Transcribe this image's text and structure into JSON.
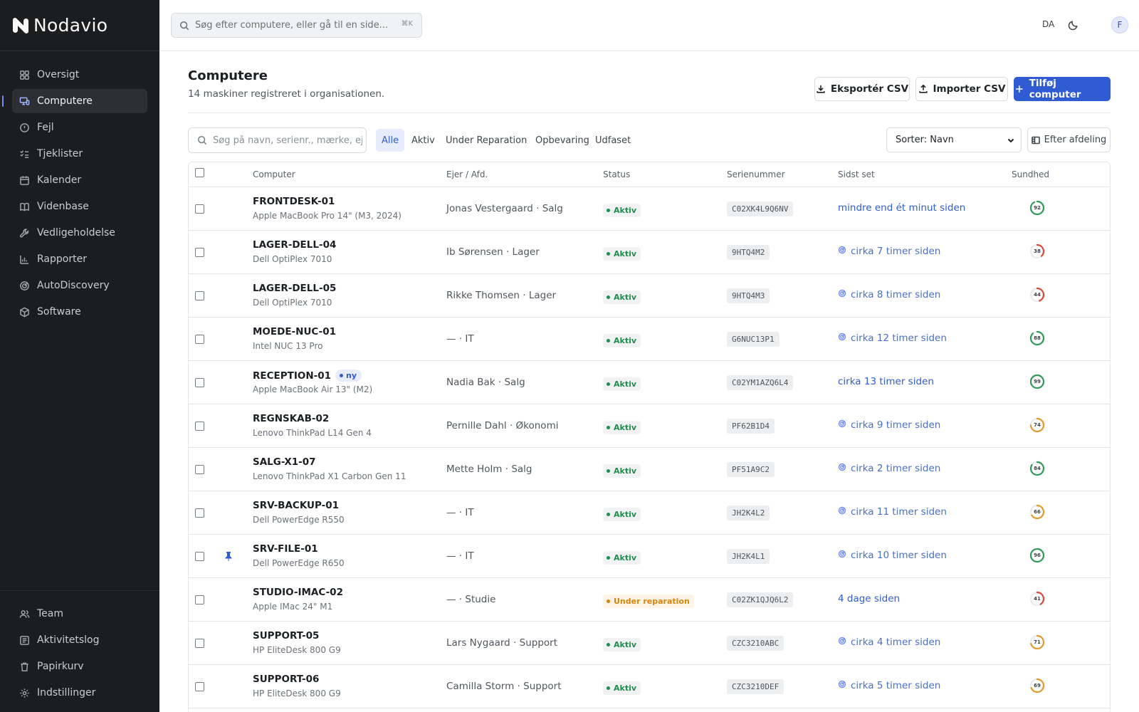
{
  "app": {
    "name": "Nodavio"
  },
  "sidebar": {
    "items": [
      {
        "label": "Oversigt",
        "icon": "grid-icon"
      },
      {
        "label": "Computere",
        "icon": "monitor-icon",
        "active": true
      },
      {
        "label": "Fejl",
        "icon": "alert-circle-icon"
      },
      {
        "label": "Tjeklister",
        "icon": "checklist-icon"
      },
      {
        "label": "Kalender",
        "icon": "calendar-icon"
      },
      {
        "label": "Videnbase",
        "icon": "book-icon"
      },
      {
        "label": "Vedligeholdelse",
        "icon": "wrench-icon"
      },
      {
        "label": "Rapporter",
        "icon": "bar-chart-icon"
      },
      {
        "label": "AutoDiscovery",
        "icon": "radar-icon"
      },
      {
        "label": "Software",
        "icon": "package-icon"
      }
    ],
    "bottom_items": [
      {
        "label": "Team",
        "icon": "users-icon"
      },
      {
        "label": "Aktivitetslog",
        "icon": "list-icon"
      },
      {
        "label": "Papirkurv",
        "icon": "trash-icon"
      },
      {
        "label": "Indstillinger",
        "icon": "gear-icon"
      }
    ]
  },
  "topbar": {
    "search_placeholder": "Søg efter computere, eller gå til en side...",
    "shortcut": "⌘K",
    "language": "DA",
    "avatar_initial": "F"
  },
  "header": {
    "title": "Computere",
    "subtitle": "14 maskiner registreret i organisationen.",
    "export_label": "Eksportér CSV",
    "import_label": "Importer CSV",
    "add_label": "Tilføj computer"
  },
  "filters": {
    "search_placeholder": "Søg på navn, serienr., mærke, ejer...",
    "tabs": [
      "Alle",
      "Aktiv",
      "Under Reparation",
      "Opbevaring",
      "Udfaset"
    ],
    "active_tab": "Alle",
    "sort_value": "Sorter: Navn",
    "group_label": "Efter afdeling"
  },
  "table": {
    "columns": [
      "Computer",
      "Ejer / Afd.",
      "Status",
      "Serienummer",
      "Sidst set",
      "Sundhed"
    ],
    "rows": [
      {
        "name": "FRONTDESK-01",
        "model": "Apple MacBook Pro 14\" (M3, 2024)",
        "owner": "Jonas Vestergaard · Salg",
        "status": "Aktiv",
        "serial": "C02XK4L9Q6NV",
        "last_seen": "mindre end ét minut siden",
        "discovered": false,
        "health": 92,
        "pinned": false,
        "new": false
      },
      {
        "name": "LAGER-DELL-04",
        "model": "Dell OptiPlex 7010",
        "owner": "Ib Sørensen · Lager",
        "status": "Aktiv",
        "serial": "9HTQ4M2",
        "last_seen": "cirka 7 timer siden",
        "discovered": true,
        "health": 38,
        "pinned": false,
        "new": false
      },
      {
        "name": "LAGER-DELL-05",
        "model": "Dell OptiPlex 7010",
        "owner": "Rikke Thomsen · Lager",
        "status": "Aktiv",
        "serial": "9HTQ4M3",
        "last_seen": "cirka 8 timer siden",
        "discovered": true,
        "health": 44,
        "pinned": false,
        "new": false
      },
      {
        "name": "MOEDE-NUC-01",
        "model": "Intel NUC 13 Pro",
        "owner": "— · IT",
        "status": "Aktiv",
        "serial": "G6NUC13P1",
        "last_seen": "cirka 12 timer siden",
        "discovered": true,
        "health": 88,
        "pinned": false,
        "new": false
      },
      {
        "name": "RECEPTION-01",
        "model": "Apple MacBook Air 13\" (M2)",
        "owner": "Nadia Bak · Salg",
        "status": "Aktiv",
        "serial": "C02YM1AZQ6L4",
        "last_seen": "cirka 13 timer siden",
        "discovered": false,
        "health": 99,
        "pinned": false,
        "new": true,
        "new_label": "ny"
      },
      {
        "name": "REGNSKAB-02",
        "model": "Lenovo ThinkPad L14 Gen 4",
        "owner": "Pernille Dahl · Økonomi",
        "status": "Aktiv",
        "serial": "PF62B1D4",
        "last_seen": "cirka 9 timer siden",
        "discovered": true,
        "health": 74,
        "pinned": false,
        "new": false
      },
      {
        "name": "SALG-X1-07",
        "model": "Lenovo ThinkPad X1 Carbon Gen 11",
        "owner": "Mette Holm · Salg",
        "status": "Aktiv",
        "serial": "PF51A9C2",
        "last_seen": "cirka 2 timer siden",
        "discovered": true,
        "health": 84,
        "pinned": false,
        "new": false
      },
      {
        "name": "SRV-BACKUP-01",
        "model": "Dell PowerEdge R550",
        "owner": "— · IT",
        "status": "Aktiv",
        "serial": "JH2K4L2",
        "last_seen": "cirka 11 timer siden",
        "discovered": true,
        "health": 66,
        "pinned": false,
        "new": false
      },
      {
        "name": "SRV-FILE-01",
        "model": "Dell PowerEdge R650",
        "owner": "— · IT",
        "status": "Aktiv",
        "serial": "JH2K4L1",
        "last_seen": "cirka 10 timer siden",
        "discovered": true,
        "health": 96,
        "pinned": true,
        "new": false
      },
      {
        "name": "STUDIO-IMAC-02",
        "model": "Apple IMac 24\" M1",
        "owner": "— · Studie",
        "status": "Under reparation",
        "serial": "C02ZK1QJQ6L2",
        "last_seen": "4 dage siden",
        "discovered": false,
        "health": 41,
        "pinned": false,
        "new": false
      },
      {
        "name": "SUPPORT-05",
        "model": "HP EliteDesk 800 G9",
        "owner": "Lars Nygaard · Support",
        "status": "Aktiv",
        "serial": "CZC3210ABC",
        "last_seen": "cirka 4 timer siden",
        "discovered": true,
        "health": 71,
        "pinned": false,
        "new": false
      },
      {
        "name": "SUPPORT-06",
        "model": "HP EliteDesk 800 G9",
        "owner": "Camilla Storm · Support",
        "status": "Aktiv",
        "serial": "CZC3210DEF",
        "last_seen": "cirka 5 timer siden",
        "discovered": true,
        "health": 69,
        "pinned": false,
        "new": false
      }
    ]
  },
  "colors": {
    "accent": "#2f5bd3",
    "sidebar_bg": "#1c1d1f",
    "status_active": "#1f8f4a",
    "status_repair": "#d4860f",
    "health_good": "#2f9a5a",
    "health_mid": "#e39a2e",
    "health_bad": "#d94a3a"
  }
}
